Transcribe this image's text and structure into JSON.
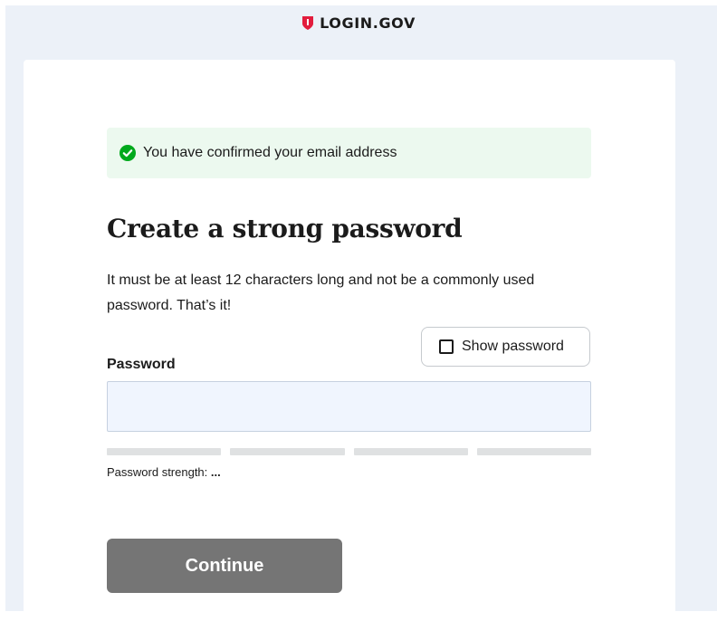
{
  "header": {
    "logo_text": "LOGIN.GOV",
    "logo_icon": "shield-icon"
  },
  "alert": {
    "icon": "check-circle-icon",
    "message": "You have confirmed your email address"
  },
  "form": {
    "title": "Create a strong password",
    "description": "It must be at least 12 characters long and not be a commonly used password. That’s it!",
    "show_password_label": "Show password",
    "show_password_checked": false,
    "password_label": "Password",
    "password_value": "",
    "strength_label": "Password strength:",
    "strength_value": "...",
    "strength_level": 0,
    "continue_label": "Continue"
  },
  "colors": {
    "brand_red": "#e21c3d",
    "success_green": "#00a91c",
    "alert_bg": "#ecf9ef",
    "input_bg": "#f0f5fe",
    "button_disabled": "#757575",
    "page_bg": "#ecf1f8"
  }
}
